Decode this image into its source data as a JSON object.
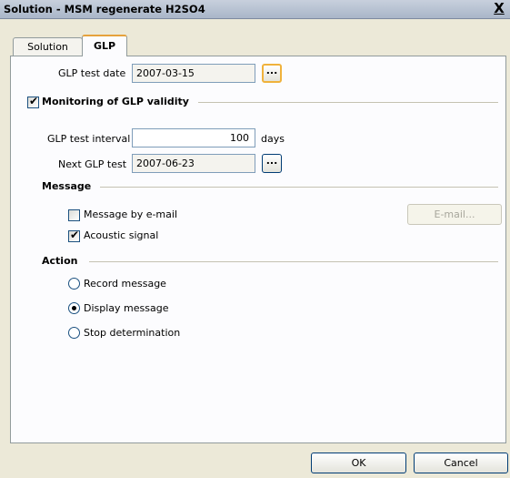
{
  "window": {
    "title": "Solution - MSM regenerate H2SO4",
    "close_glyph": "X"
  },
  "tabs": [
    {
      "label": "Solution",
      "active": false
    },
    {
      "label": "GLP",
      "active": true
    }
  ],
  "glp": {
    "test_date_label": "GLP test date",
    "test_date_value": "2007-03-15",
    "browse_glyph": "...",
    "monitoring": {
      "label": "Monitoring of GLP validity",
      "checked": true
    },
    "interval_label": "GLP test interval",
    "interval_value": "100",
    "interval_unit": "days",
    "next_label": "Next GLP test",
    "next_value": "2007-06-23"
  },
  "message": {
    "heading": "Message",
    "by_email": {
      "label": "Message by e-mail",
      "checked": false
    },
    "email_button": "E-mail...",
    "acoustic": {
      "label": "Acoustic signal",
      "checked": true
    }
  },
  "action": {
    "heading": "Action",
    "options": [
      {
        "label": "Record message",
        "selected": false
      },
      {
        "label": "Display message",
        "selected": true
      },
      {
        "label": "Stop determination",
        "selected": false
      }
    ]
  },
  "buttons": {
    "ok": "OK",
    "cancel": "Cancel"
  }
}
